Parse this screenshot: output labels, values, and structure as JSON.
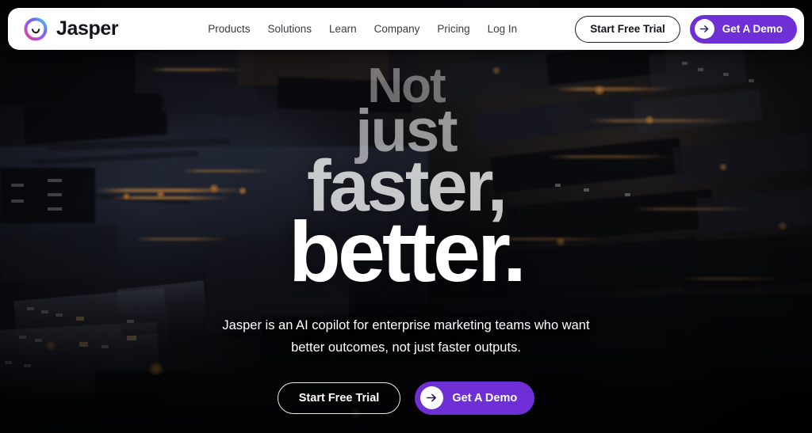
{
  "brand": {
    "name": "Jasper",
    "logo_icon": "jasper-smiley-orb-icon"
  },
  "header": {
    "nav": [
      {
        "label": "Products"
      },
      {
        "label": "Solutions"
      },
      {
        "label": "Learn"
      },
      {
        "label": "Company"
      },
      {
        "label": "Pricing"
      },
      {
        "label": "Log In"
      }
    ],
    "start_trial_label": "Start Free Trial",
    "demo_label": "Get A Demo",
    "demo_icon": "arrow-right-icon"
  },
  "hero": {
    "headline_lines": [
      "Not",
      "just",
      "faster,",
      "better."
    ],
    "subhead_line_1": "Jasper is an AI copilot for enterprise marketing teams who want",
    "subhead_line_2": "better outcomes, not just faster outputs.",
    "start_trial_label": "Start Free Trial",
    "demo_label": "Get A Demo",
    "demo_icon": "arrow-right-icon",
    "background": "aerial-night-cityscape-photo"
  },
  "colors": {
    "brand_purple": "#6F2FD6",
    "header_surface": "#FFFFFF",
    "header_text": "#15151C",
    "nav_text": "#3A3A42",
    "hero_text": "#FFFFFF",
    "page_background": "#070608"
  }
}
